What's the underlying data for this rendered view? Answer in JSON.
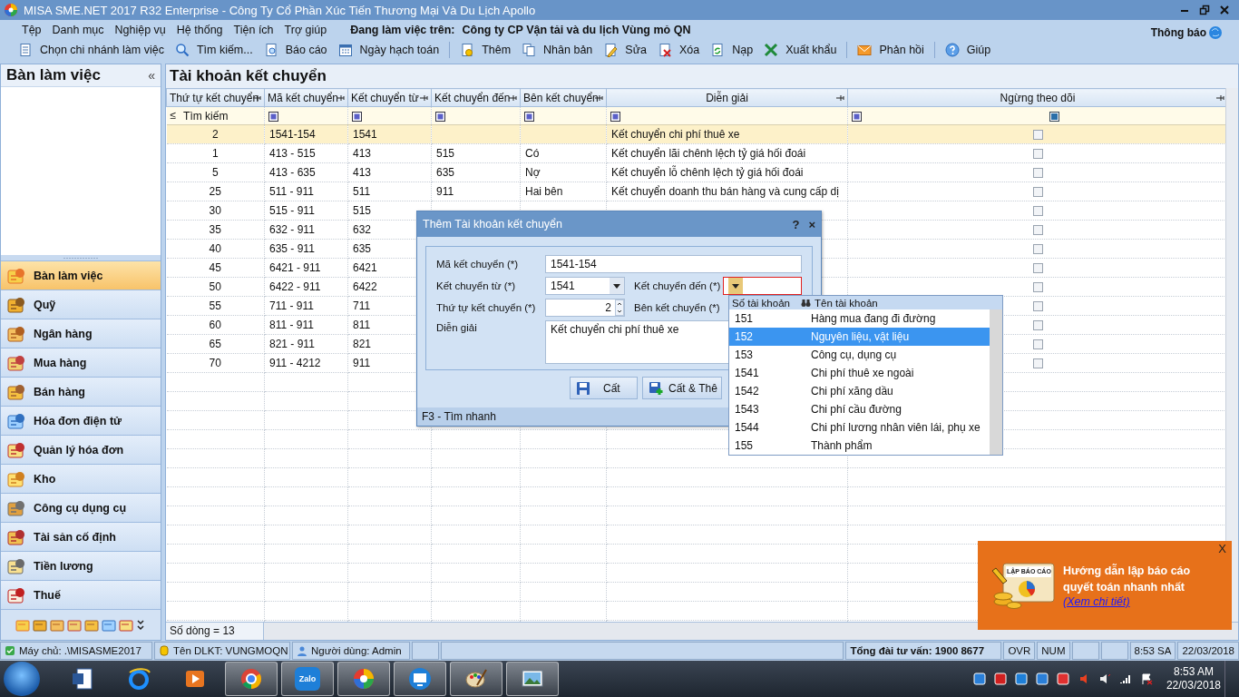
{
  "window": {
    "title": "MISA SME.NET 2017 R32 Enterprise - Công Ty Cổ Phần Xúc Tiến Thương Mại Và Du Lịch Apollo"
  },
  "menu": [
    "Tệp",
    "Danh mục",
    "Nghiệp vụ",
    "Hệ thống",
    "Tiện ích",
    "Trợ giúp"
  ],
  "working_on": {
    "label": "Đang làm việc trên:",
    "company": "Công ty CP Vận tải và du lịch Vùng mỏ QN"
  },
  "notifications_label": "Thông báo",
  "toolbar": [
    {
      "kind": "branch",
      "label": "Chọn chi nhánh làm việc"
    },
    {
      "kind": "search",
      "label": "Tìm kiếm..."
    },
    {
      "kind": "report",
      "label": "Báo cáo"
    },
    {
      "kind": "calendar",
      "label": "Ngày hạch toán"
    },
    {
      "kind": "separator"
    },
    {
      "kind": "add",
      "label": "Thêm"
    },
    {
      "kind": "copy",
      "label": "Nhân bản"
    },
    {
      "kind": "edit",
      "label": "Sửa"
    },
    {
      "kind": "delete",
      "label": "Xóa"
    },
    {
      "kind": "reload",
      "label": "Nạp"
    },
    {
      "kind": "export",
      "label": "Xuất khẩu"
    },
    {
      "kind": "separator"
    },
    {
      "kind": "feedback",
      "label": "Phản hồi"
    },
    {
      "kind": "separator"
    },
    {
      "kind": "help",
      "label": "Giúp"
    }
  ],
  "sidebar": {
    "title": "Bàn làm việc",
    "collapse_glyph": "«",
    "items": [
      {
        "label": "Bàn làm việc",
        "selected": true
      },
      {
        "label": "Quỹ",
        "selected": false
      },
      {
        "label": "Ngân hàng",
        "selected": false
      },
      {
        "label": "Mua hàng",
        "selected": false
      },
      {
        "label": "Bán hàng",
        "selected": false
      },
      {
        "label": "Hóa đơn điện tử",
        "selected": false
      },
      {
        "label": "Quản lý hóa đơn",
        "selected": false
      },
      {
        "label": "Kho",
        "selected": false
      },
      {
        "label": "Công cụ dụng cụ",
        "selected": false
      },
      {
        "label": "Tài sản cố định",
        "selected": false
      },
      {
        "label": "Tiền lương",
        "selected": false
      },
      {
        "label": "Thuế",
        "selected": false
      }
    ]
  },
  "main": {
    "title": "Tài khoản kết chuyển",
    "columns": [
      "Thứ tự kết chuyển",
      "Mã kết chuyển",
      "Kết chuyển từ",
      "Kết chuyển đến",
      "Bên kết chuyển",
      "Diễn giải",
      "Ngừng theo dõi"
    ],
    "filter": {
      "operator": "≤",
      "placeholder": "Tìm kiếm",
      "checkbox_indeterminate": true
    },
    "rows": [
      {
        "order": "2",
        "code": "1541-154",
        "from": "1541",
        "description": "Kết chuyển chi phí thuê xe",
        "stopped": false,
        "selected": true
      },
      {
        "order": "1",
        "code": "413 - 515",
        "from": "413",
        "to": "515",
        "side": "Có",
        "description": "Kết chuyển lãi chênh lệch tỷ giá hối đoái",
        "stopped": false,
        "selected": false
      },
      {
        "order": "5",
        "code": "413 - 635",
        "from": "413",
        "to": "635",
        "side": "Nợ",
        "description": "Kết chuyển lỗ chênh lệch tỷ giá hối đoái",
        "stopped": false,
        "selected": false
      },
      {
        "order": "25",
        "code": "511 - 911",
        "from": "511",
        "to": "911",
        "side": "Hai bên",
        "description": "Kết chuyển doanh thu bán hàng và cung cấp dị",
        "stopped": false,
        "selected": false
      },
      {
        "order": "30",
        "code": "515 - 911",
        "from": "515",
        "stopped": false,
        "selected": false
      },
      {
        "order": "35",
        "code": "632 - 911",
        "from": "632",
        "stopped": false,
        "selected": false
      },
      {
        "order": "40",
        "code": "635 - 911",
        "from": "635",
        "stopped": false,
        "selected": false
      },
      {
        "order": "45",
        "code": "6421 - 911",
        "from": "6421",
        "stopped": false,
        "selected": false
      },
      {
        "order": "50",
        "code": "6422 - 911",
        "from": "6422",
        "stopped": false,
        "selected": false
      },
      {
        "order": "55",
        "code": "711 - 911",
        "from": "711",
        "stopped": false,
        "selected": false
      },
      {
        "order": "60",
        "code": "811 - 911",
        "from": "811",
        "stopped": false,
        "selected": false
      },
      {
        "order": "65",
        "code": "821 - 911",
        "from": "821",
        "stopped": false,
        "selected": false
      },
      {
        "order": "70",
        "code": "911 - 4212",
        "from": "911",
        "stopped": false,
        "selected": false
      }
    ],
    "footer": "Số dòng = 13"
  },
  "dialog": {
    "title": "Thêm Tài khoản kết chuyển",
    "help_glyph": "?",
    "close_glyph": "×",
    "code": {
      "label": "Mã kết chuyển (*)",
      "value": "1541-154"
    },
    "from": {
      "label": "Kết chuyển từ (*)",
      "value": "1541"
    },
    "to": {
      "label": "Kết chuyển đến (*)",
      "invalid": true
    },
    "order": {
      "label": "Thứ tự kết chuyển (*)",
      "value": "2"
    },
    "side": {
      "label": "Bên kết chuyển (*)"
    },
    "description": {
      "label": "Diễn giải",
      "value": "Kết chuyển chi phí thuê xe"
    },
    "buttons": [
      {
        "kind": "save",
        "label": "Cất"
      },
      {
        "kind": "save_new",
        "label": "Cất & Thê"
      }
    ],
    "hint": "F3 - Tìm nhanh"
  },
  "dropdown": {
    "columns": [
      "Số tài khoản",
      "Tên tài khoản"
    ],
    "rows": [
      {
        "number": "151",
        "name": "Hàng mua đang đi đường",
        "selected": false
      },
      {
        "number": "152",
        "name": "Nguyên liệu, vật liệu",
        "selected": true
      },
      {
        "number": "153",
        "name": "Công cụ, dụng cụ",
        "selected": false
      },
      {
        "number": "1541",
        "name": "Chi phí thuê xe ngoài",
        "selected": false
      },
      {
        "number": "1542",
        "name": "Chi phí xăng dầu",
        "selected": false
      },
      {
        "number": "1543",
        "name": "Chi phí cầu đường",
        "selected": false
      },
      {
        "number": "1544",
        "name": "Chi phí lương nhân viên lái, phụ xe",
        "selected": false
      },
      {
        "number": "155",
        "name": "Thành phẩm",
        "selected": false
      }
    ]
  },
  "popup": {
    "close_glyph": "X",
    "icon_caption": "LẬP BÁO CÁO",
    "text": "Hướng dẫn lập báo cáo quyết toán nhanh nhất",
    "link": "(Xem chi tiết)"
  },
  "status_bar": [
    {
      "kind": "server",
      "text": "Máy chủ: .\\MISASME2017"
    },
    {
      "kind": "database",
      "text": "Tên DLKT: VUNGMOQN"
    },
    {
      "kind": "user",
      "text": "Người dùng: Admin"
    },
    {
      "kind": "empty_small"
    },
    {
      "kind": "empty_wide"
    },
    {
      "kind": "hotline",
      "text": "Tổng đài tư vấn: 1900 8677"
    },
    {
      "kind": "plain",
      "text": "OVR"
    },
    {
      "kind": "plain",
      "text": "NUM"
    },
    {
      "kind": "empty_small"
    },
    {
      "kind": "empty_small"
    },
    {
      "kind": "plain",
      "text": "8:53 SA"
    },
    {
      "kind": "plain",
      "text": "22/03/2018"
    }
  ],
  "taskbar": {
    "apps": [
      {
        "kind": "word",
        "running": false
      },
      {
        "kind": "browser",
        "running": false
      },
      {
        "kind": "media",
        "running": false
      },
      {
        "kind": "chrome",
        "running": true
      },
      {
        "kind": "chat",
        "label": "Zalo",
        "running": true
      },
      {
        "kind": "pinwheel",
        "running": true
      },
      {
        "kind": "monitor",
        "running": true
      },
      {
        "kind": "palette",
        "running": true
      },
      {
        "kind": "image",
        "running": true
      }
    ],
    "time": "8:53 AM",
    "date": "22/03/2018"
  }
}
